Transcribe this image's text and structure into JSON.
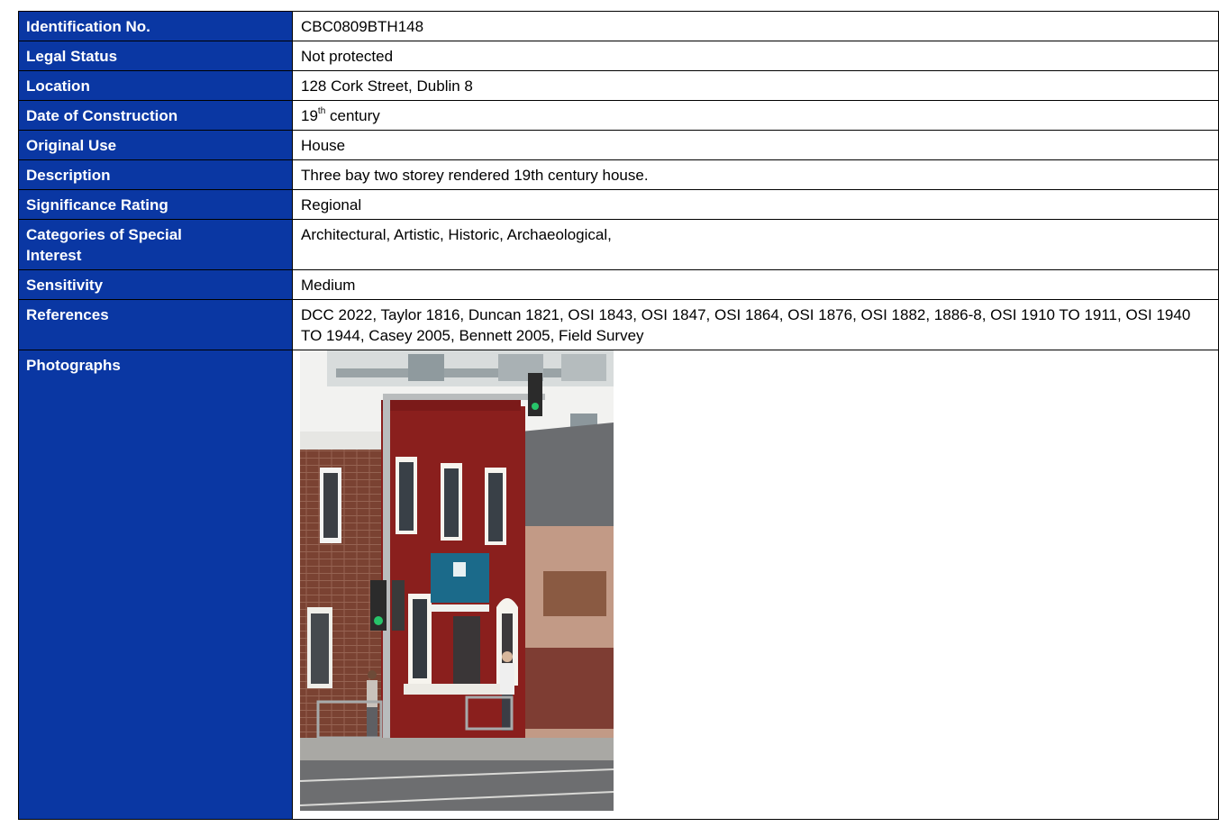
{
  "record": {
    "identification_no": {
      "label": "Identification No.",
      "value": "CBC0809BTH148"
    },
    "legal_status": {
      "label": "Legal Status",
      "value": "Not protected"
    },
    "location": {
      "label": "Location",
      "value": "128 Cork Street, Dublin 8"
    },
    "date_of_construction": {
      "label": "Date of Construction",
      "value_num": "19",
      "value_sup": "th",
      "value_rest": " century"
    },
    "original_use": {
      "label": "Original Use",
      "value": "House"
    },
    "description": {
      "label": "Description",
      "value": "Three bay two storey rendered 19th century house."
    },
    "significance_rating": {
      "label": "Significance Rating",
      "value": "Regional"
    },
    "categories": {
      "label": "Categories of Special Interest",
      "value": "Architectural, Artistic, Historic, Archaeological,"
    },
    "sensitivity": {
      "label": "Sensitivity",
      "value": "Medium"
    },
    "references": {
      "label": "References",
      "value": "DCC 2022, Taylor 1816, Duncan 1821, OSI 1843, OSI 1847, OSI 1864, OSI 1876, OSI 1882, 1886-8, OSI 1910 TO 1911, OSI 1940 TO 1944, Casey 2005, Bennett 2005, Field Survey"
    },
    "photographs": {
      "label": "Photographs"
    }
  },
  "colors": {
    "label_bg": "#0a37a3",
    "label_text": "#ffffff",
    "border": "#000000"
  }
}
